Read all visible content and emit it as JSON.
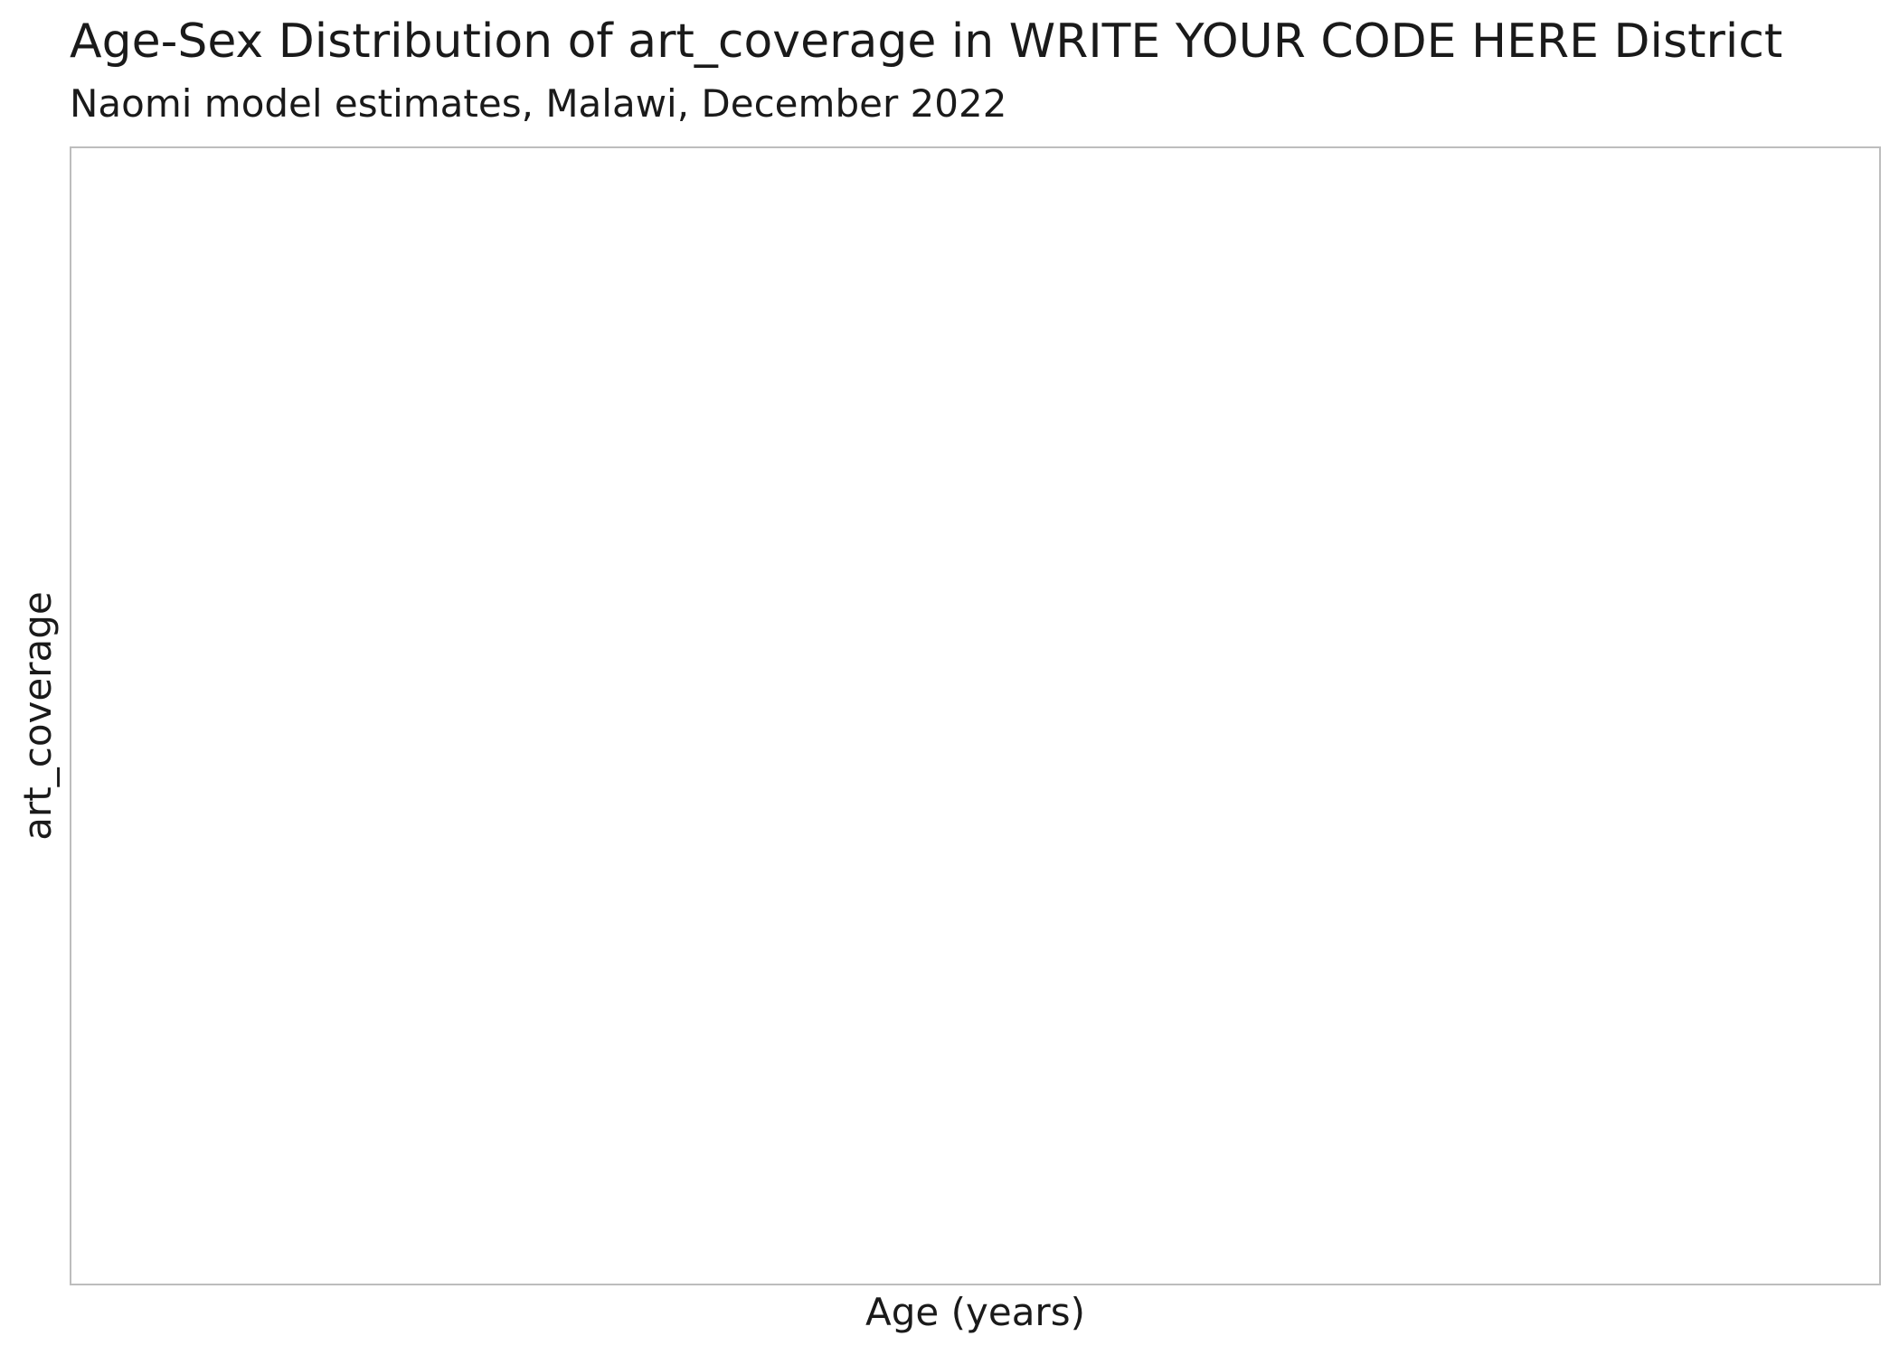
{
  "chart_data": {
    "type": "bar",
    "title": "Age-Sex Distribution of art_coverage in WRITE YOUR CODE HERE District",
    "subtitle": "Naomi model estimates, Malawi, December 2022",
    "xlabel": "Age (years)",
    "ylabel": "art_coverage",
    "categories": [],
    "series": [],
    "grid": false,
    "legend": "none"
  }
}
